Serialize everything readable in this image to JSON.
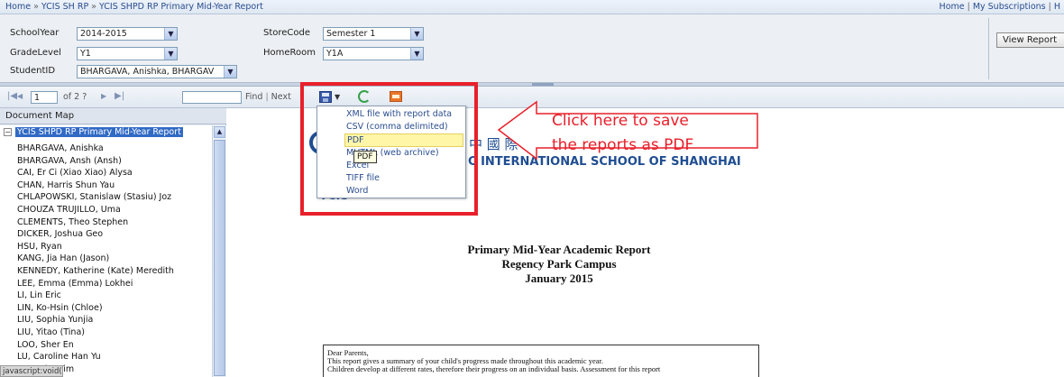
{
  "breadcrumb": {
    "items": [
      "Home",
      "YCIS SH RP",
      "YCIS SHPD RP Primary Mid-Year Report"
    ],
    "separator": "»"
  },
  "top_links": {
    "home": "Home",
    "subscriptions": "My Subscriptions",
    "help_fragment": "H",
    "separator": "|"
  },
  "params": {
    "school_year": {
      "label": "SchoolYear",
      "value": "2014-2015"
    },
    "store_code": {
      "label": "StoreCode",
      "value": "Semester 1"
    },
    "grade_level": {
      "label": "GradeLevel",
      "value": "Y1"
    },
    "home_room": {
      "label": "HomeRoom",
      "value": "Y1A"
    },
    "student_id": {
      "label": "StudentID",
      "value": "BHARGAVA, Anishka, BHARGAV"
    },
    "view_report": "View Report"
  },
  "toolbar": {
    "first": "|◀",
    "prev": "◀",
    "page_value": "1",
    "page_of": "of 2 ?",
    "next": "▶",
    "last": "▶|",
    "find": "Find",
    "find_next": "Next",
    "find_sep": "|"
  },
  "doc_map": {
    "title": "Document Map",
    "root": "YCIS SHPD RP Primary Mid-Year Report",
    "students": [
      "BHARGAVA, Anishka",
      "BHARGAVA, Ansh (Ansh)",
      "CAI, Er Ci (Xiao Xiao) Alysa",
      "CHAN, Harris Shun Yau",
      "CHLAPOWSKI, Stanislaw (Stasiu) Joz",
      "CHOUZA TRUJILLO, Uma",
      "CLEMENTS, Theo Stephen",
      "DICKER, Joshua Geo",
      "HSU, Ryan",
      "KANG, Jia Han (Jason)",
      "KENNEDY, Katherine (Kate) Meredith",
      "LEE, Emma (Emma) Lokhei",
      "LI, Lin Eric",
      "LIN, Ko-Hsin (Chloe)",
      "LIU, Sophia Yunjia",
      "LIU, Yitao (Tina)",
      "LOO, Sher En",
      "LU, Caroline Han Yu",
      "LUO, Tim Tim"
    ]
  },
  "status_bar": "javascript:void(0)",
  "export_menu": {
    "items": [
      "XML file with report data",
      "CSV (comma delimited)",
      "PDF",
      "MHTML (web archive)",
      "Excel",
      "TIFF file",
      "Word"
    ],
    "highlighted": "PDF",
    "tooltip": "PDF"
  },
  "report": {
    "school_cn": "中 國 際 學",
    "school_en": "C INTERNATIONAL SCHOOL OF SHANGHAI",
    "logo_text": "YCIS",
    "title_lines": [
      "Primary Mid-Year Academic Report",
      "Regency Park Campus",
      "January 2015"
    ],
    "letter": [
      "Dear Parents,",
      "This report gives a summary of your child's progress made throughout this academic year.",
      "Children develop at different rates, therefore their progress on an individual basis. Assessment for this report"
    ]
  },
  "annotation": {
    "lines": [
      "Click here to save",
      "the reports as PDF"
    ],
    "color": "#e8202a"
  }
}
